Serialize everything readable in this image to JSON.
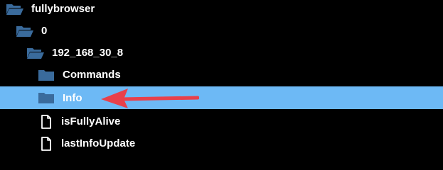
{
  "tree": {
    "items": [
      {
        "label": "fullybrowser",
        "type": "folder-open",
        "depth": 0,
        "selected": false
      },
      {
        "label": "0",
        "type": "folder-open",
        "depth": 1,
        "selected": false
      },
      {
        "label": "192_168_30_8",
        "type": "folder-open",
        "depth": 2,
        "selected": false
      },
      {
        "label": "Commands",
        "type": "folder",
        "depth": 3,
        "selected": false
      },
      {
        "label": "Info",
        "type": "folder",
        "depth": 3,
        "selected": true
      },
      {
        "label": "isFullyAlive",
        "type": "file",
        "depth": 3,
        "selected": false
      },
      {
        "label": "lastInfoUpdate",
        "type": "file",
        "depth": 3,
        "selected": false
      }
    ]
  },
  "colors": {
    "background": "#000000",
    "folder": "#3a6b9c",
    "selected_row": "#6db9f5",
    "text": "#ffffff",
    "annotation_arrow": "#e8404a"
  }
}
